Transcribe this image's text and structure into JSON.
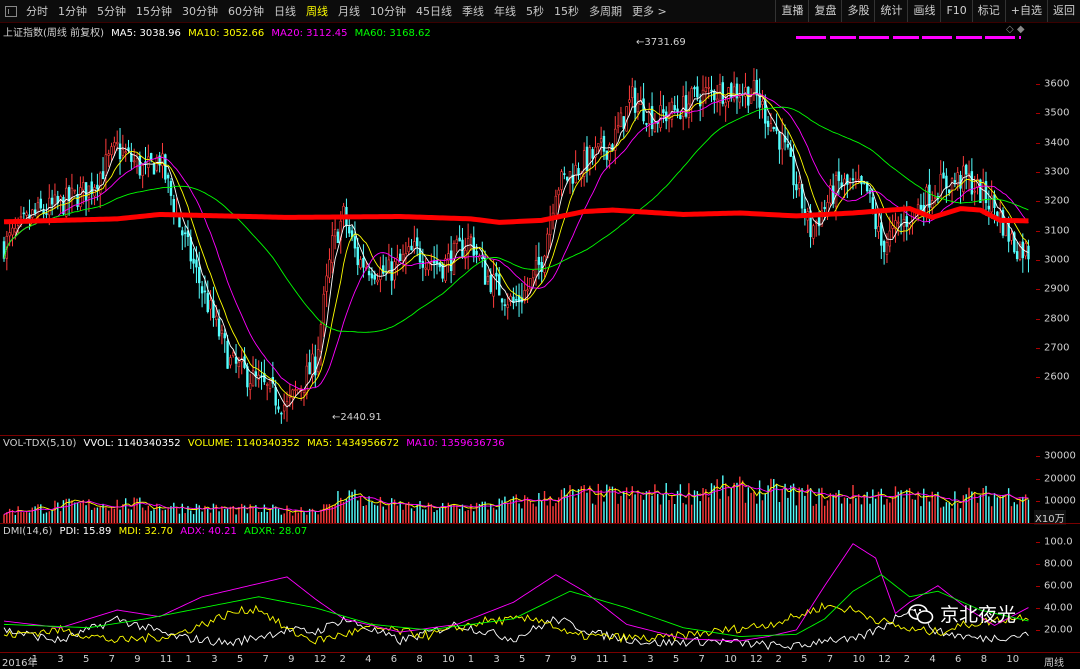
{
  "toolbar": {
    "periods": [
      "分时",
      "1分钟",
      "5分钟",
      "15分钟",
      "30分钟",
      "60分钟",
      "日线",
      "周线",
      "月线",
      "10分钟",
      "45日线",
      "季线",
      "年线",
      "5秒",
      "15秒",
      "多周期",
      "更多 >"
    ],
    "active_period": "周线",
    "right_buttons": [
      "直播",
      "复盘",
      "多股",
      "统计",
      "画线",
      "F10",
      "标记",
      "+自选",
      "返回"
    ]
  },
  "price_pane": {
    "title": "上证指数(周线 前复权)",
    "ma5": "MA5: 3038.96",
    "ma10": "MA10: 3052.66",
    "ma20": "MA20: 3112.45",
    "ma60": "MA60: 3168.62",
    "high_label": "3731.69",
    "low_label": "2440.91",
    "y_ticks": [
      "3600",
      "3500",
      "3400",
      "3300",
      "3200",
      "3100",
      "3000",
      "2900",
      "2800",
      "2700",
      "2600"
    ],
    "corner_icons": "◇ ◆"
  },
  "volume_pane": {
    "title": "VOL-TDX(5,10)",
    "vvol": "VVOL: 1140340352",
    "volume": "VOLUME: 1140340352",
    "ma5": "MA5: 1434956672",
    "ma10": "MA10: 1359636736",
    "y_ticks": [
      "30000",
      "20000",
      "10000"
    ],
    "unit": "X10万"
  },
  "dmi_pane": {
    "title": "DMI(14,6)",
    "pdi": "PDI: 15.89",
    "mdi": "MDI: 32.70",
    "adx": "ADX: 40.21",
    "adxr": "ADXR: 28.07",
    "y_ticks": [
      "100.0",
      "80.00",
      "60.00",
      "40.00",
      "20.00"
    ]
  },
  "x_axis": {
    "labels": [
      "2016年",
      "1",
      "3",
      "5",
      "7",
      "9",
      "11",
      "1",
      "3",
      "5",
      "7",
      "9",
      "12",
      "2",
      "4",
      "6",
      "8",
      "10",
      "1",
      "3",
      "5",
      "7",
      "9",
      "11",
      "1",
      "3",
      "5",
      "7",
      "10",
      "12",
      "2",
      "5",
      "7",
      "10",
      "12",
      "2",
      "4",
      "6",
      "8",
      "10"
    ],
    "period_label": "周线"
  },
  "watermark": {
    "text": "京北夜光",
    "icon": "wechat-icon"
  },
  "colors": {
    "up": "#ff3c3c",
    "down": "#54ffff",
    "ma5": "#ffffff",
    "ma10": "#ffff00",
    "ma20": "#ff00ff",
    "ma60": "#00ff00",
    "cost_line": "#ff0000"
  },
  "chart_data": {
    "type": "candlestick",
    "price_range": [
      2440.91,
      3731.69
    ],
    "price_axis_range": [
      2400,
      3770
    ],
    "volume_axis_range": [
      0,
      33000
    ],
    "dmi_axis_range": [
      0,
      105
    ],
    "series": [
      {
        "name": "MA5",
        "last": 3038.96
      },
      {
        "name": "MA10",
        "last": 3052.66
      },
      {
        "name": "MA20",
        "last": 3112.45
      },
      {
        "name": "MA60",
        "last": 3168.62
      }
    ],
    "close_keypoints": [
      [
        0,
        3050
      ],
      [
        10,
        3150
      ],
      [
        20,
        3190
      ],
      [
        30,
        3240
      ],
      [
        40,
        3380
      ],
      [
        50,
        3300
      ],
      [
        55,
        3350
      ],
      [
        62,
        3120
      ],
      [
        70,
        2900
      ],
      [
        80,
        2650
      ],
      [
        90,
        2580
      ],
      [
        100,
        2500
      ],
      [
        110,
        2650
      ],
      [
        116,
        3050
      ],
      [
        120,
        3150
      ],
      [
        125,
        3000
      ],
      [
        135,
        2950
      ],
      [
        145,
        3030
      ],
      [
        155,
        2980
      ],
      [
        165,
        3070
      ],
      [
        170,
        2950
      ],
      [
        180,
        2850
      ],
      [
        185,
        2900
      ],
      [
        190,
        3000
      ],
      [
        195,
        3250
      ],
      [
        205,
        3330
      ],
      [
        215,
        3400
      ],
      [
        222,
        3550
      ],
      [
        230,
        3480
      ],
      [
        240,
        3520
      ],
      [
        245,
        3560
      ],
      [
        255,
        3580
      ],
      [
        265,
        3570
      ],
      [
        275,
        3400
      ],
      [
        285,
        3100
      ],
      [
        295,
        3260
      ],
      [
        305,
        3230
      ],
      [
        310,
        3050
      ],
      [
        320,
        3150
      ],
      [
        330,
        3250
      ],
      [
        340,
        3280
      ],
      [
        350,
        3180
      ],
      [
        357,
        3050
      ],
      [
        362,
        3030
      ]
    ],
    "cost_line_keypoints": [
      [
        0,
        3130
      ],
      [
        40,
        3140
      ],
      [
        55,
        3155
      ],
      [
        100,
        3145
      ],
      [
        140,
        3148
      ],
      [
        165,
        3140
      ],
      [
        175,
        3128
      ],
      [
        190,
        3135
      ],
      [
        205,
        3165
      ],
      [
        215,
        3170
      ],
      [
        240,
        3155
      ],
      [
        260,
        3160
      ],
      [
        280,
        3150
      ],
      [
        300,
        3160
      ],
      [
        320,
        3175
      ],
      [
        328,
        3145
      ],
      [
        338,
        3175
      ],
      [
        345,
        3170
      ],
      [
        352,
        3135
      ],
      [
        362,
        3133
      ]
    ],
    "volume_keypoints": [
      [
        0,
        5500
      ],
      [
        20,
        8000
      ],
      [
        40,
        9000
      ],
      [
        60,
        7500
      ],
      [
        80,
        6500
      ],
      [
        100,
        6000
      ],
      [
        115,
        7000
      ],
      [
        120,
        14500
      ],
      [
        130,
        9000
      ],
      [
        150,
        7000
      ],
      [
        170,
        8000
      ],
      [
        190,
        11000
      ],
      [
        200,
        13000
      ],
      [
        220,
        12500
      ],
      [
        240,
        13500
      ],
      [
        250,
        15500
      ],
      [
        270,
        14500
      ],
      [
        290,
        12000
      ],
      [
        310,
        13000
      ],
      [
        330,
        11000
      ],
      [
        350,
        12500
      ],
      [
        362,
        13500
      ]
    ],
    "dmi_keypoints": {
      "PDI": [
        [
          0,
          20
        ],
        [
          20,
          10
        ],
        [
          40,
          30
        ],
        [
          60,
          14
        ],
        [
          80,
          8
        ],
        [
          100,
          20
        ],
        [
          110,
          18
        ],
        [
          120,
          30
        ],
        [
          140,
          10
        ],
        [
          160,
          25
        ],
        [
          180,
          12
        ],
        [
          195,
          30
        ],
        [
          210,
          16
        ],
        [
          230,
          8
        ],
        [
          250,
          10
        ],
        [
          270,
          6
        ],
        [
          282,
          5
        ],
        [
          290,
          12
        ],
        [
          300,
          10
        ],
        [
          310,
          22
        ],
        [
          320,
          40
        ],
        [
          330,
          18
        ],
        [
          345,
          12
        ],
        [
          362,
          15.89
        ]
      ],
      "MDI": [
        [
          0,
          15
        ],
        [
          20,
          20
        ],
        [
          40,
          10
        ],
        [
          60,
          15
        ],
        [
          80,
          35
        ],
        [
          90,
          40
        ],
        [
          100,
          20
        ],
        [
          110,
          10
        ],
        [
          130,
          22
        ],
        [
          150,
          15
        ],
        [
          170,
          28
        ],
        [
          190,
          30
        ],
        [
          200,
          15
        ],
        [
          230,
          12
        ],
        [
          250,
          18
        ],
        [
          270,
          25
        ],
        [
          280,
          32
        ],
        [
          290,
          42
        ],
        [
          300,
          38
        ],
        [
          310,
          28
        ],
        [
          320,
          20
        ],
        [
          330,
          18
        ],
        [
          340,
          25
        ],
        [
          362,
          32.7
        ]
      ],
      "ADX": [
        [
          0,
          28
        ],
        [
          20,
          22
        ],
        [
          40,
          38
        ],
        [
          55,
          32
        ],
        [
          70,
          50
        ],
        [
          90,
          62
        ],
        [
          100,
          68
        ],
        [
          110,
          48
        ],
        [
          120,
          30
        ],
        [
          140,
          18
        ],
        [
          160,
          25
        ],
        [
          180,
          45
        ],
        [
          195,
          70
        ],
        [
          205,
          55
        ],
        [
          220,
          25
        ],
        [
          240,
          12
        ],
        [
          260,
          10
        ],
        [
          270,
          14
        ],
        [
          280,
          20
        ],
        [
          290,
          60
        ],
        [
          300,
          98
        ],
        [
          308,
          85
        ],
        [
          315,
          35
        ],
        [
          320,
          45
        ],
        [
          330,
          60
        ],
        [
          340,
          40
        ],
        [
          350,
          24
        ],
        [
          362,
          40.21
        ]
      ],
      "ADXR": [
        [
          0,
          25
        ],
        [
          30,
          22
        ],
        [
          50,
          30
        ],
        [
          70,
          40
        ],
        [
          90,
          50
        ],
        [
          110,
          40
        ],
        [
          130,
          25
        ],
        [
          150,
          20
        ],
        [
          180,
          30
        ],
        [
          200,
          55
        ],
        [
          220,
          40
        ],
        [
          240,
          22
        ],
        [
          260,
          14
        ],
        [
          280,
          16
        ],
        [
          290,
          30
        ],
        [
          300,
          55
        ],
        [
          310,
          70
        ],
        [
          320,
          50
        ],
        [
          330,
          55
        ],
        [
          345,
          38
        ],
        [
          362,
          28.07
        ]
      ]
    }
  }
}
